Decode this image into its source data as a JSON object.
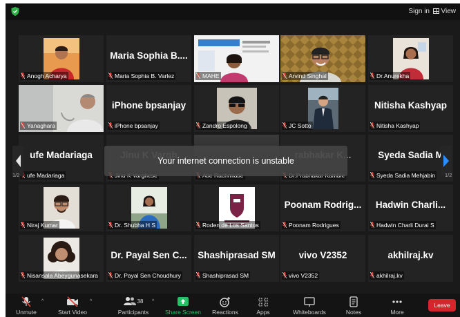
{
  "topbar": {
    "signin": "Sign in",
    "view": "View"
  },
  "tiles": [
    {
      "name": "",
      "label": "Anogh Acharya",
      "photo": "man-red-shirt"
    },
    {
      "name": "Maria Sophia B....",
      "label": "Maria Sophia B. Varlez",
      "photo": ""
    },
    {
      "name": "",
      "label": "MAHE",
      "photo": "woman-slide"
    },
    {
      "name": "",
      "label": "Arvind Singhal",
      "photo": "man-glasses",
      "speaking": true
    },
    {
      "name": "",
      "label": "Dr.Anurekha",
      "photo": "woman-red"
    },
    {
      "name": "",
      "label": "Yanaghara",
      "photo": "man-side"
    },
    {
      "name": "iPhone bpsanjay",
      "label": "iPhone bpsanjay",
      "photo": ""
    },
    {
      "name": "",
      "label": "Zandro Espolong",
      "photo": "man-dark-glasses"
    },
    {
      "name": "",
      "label": "JC Sotto",
      "photo": "man-suit"
    },
    {
      "name": "Nitisha Kashyap",
      "label": "Nitisha Kashyap",
      "photo": ""
    },
    {
      "name": "ufe Madariaga",
      "label": "ufe Madariaga",
      "photo": ""
    },
    {
      "name": "Jinu K Vargh",
      "label": "Jinu K Varghese",
      "photo": "",
      "dim": true
    },
    {
      "name": "",
      "label": "Atie Rachmiatie",
      "photo": ""
    },
    {
      "name": "rabhakar K...",
      "label": "Dr.Prabhakar Kamble",
      "photo": "",
      "dim": true
    },
    {
      "name": "Syeda Sadia M",
      "label": "Syeda Sadia Mehjabin",
      "photo": ""
    },
    {
      "name": "",
      "label": "Niraj Kumar",
      "photo": "man-white-glasses"
    },
    {
      "name": "",
      "label": "Dr. Shubha H S",
      "photo": "woman-blue"
    },
    {
      "name": "",
      "label": "Roden de Los Santos",
      "photo": "logo"
    },
    {
      "name": "Poonam Rodrig...",
      "label": "Poonam Rodrigues",
      "photo": ""
    },
    {
      "name": "Hadwin Charli...",
      "label": "Hadwin Charli Durai S",
      "photo": ""
    },
    {
      "name": "",
      "label": "Nisansala Abeygunasekara",
      "photo": "woman-curly"
    },
    {
      "name": "Dr. Payal Sen C...",
      "label": "Dr. Payal Sen Choudhury",
      "photo": ""
    },
    {
      "name": "Shashiprasad SM",
      "label": "Shashiprasad SM",
      "photo": ""
    },
    {
      "name": "vivo V2352",
      "label": "vivo V2352",
      "photo": ""
    },
    {
      "name": "akhilraj.kv",
      "label": "akhilraj.kv",
      "photo": ""
    }
  ],
  "toast": "Your internet connection is unstable",
  "pages": {
    "left": "1/2",
    "right": "1/2"
  },
  "toolbar": {
    "unmute": "Unmute",
    "start_video": "Start Video",
    "participants": "Participants",
    "participants_count": "38",
    "share_screen": "Share Screen",
    "reactions": "Reactions",
    "apps": "Apps",
    "whiteboards": "Whiteboards",
    "notes": "Notes",
    "more": "More",
    "leave": "Leave"
  },
  "colors": {
    "speaking_border": "#d6cf3a",
    "share_green": "#26c167",
    "leave_red": "#d6262b",
    "muted_red": "#e0443a"
  }
}
